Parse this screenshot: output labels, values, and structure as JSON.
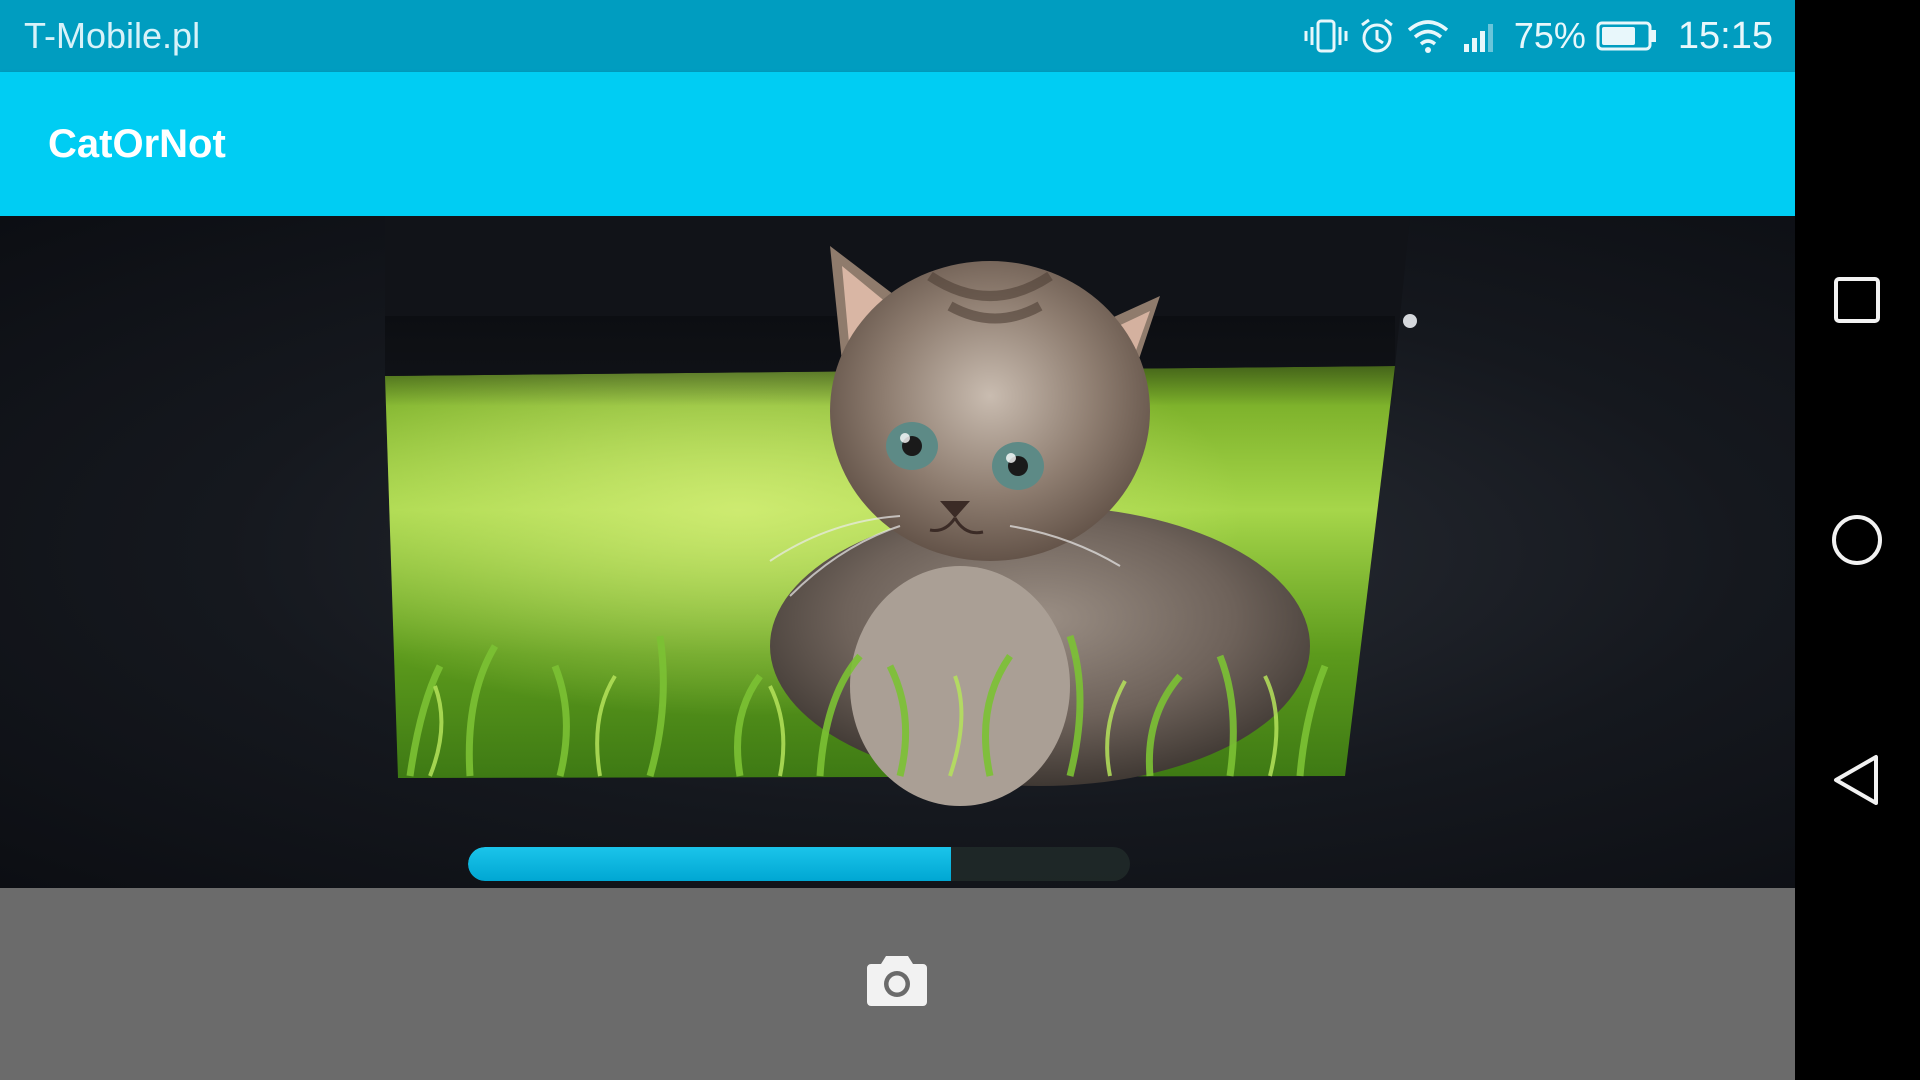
{
  "status_bar": {
    "carrier": "T-Mobile.pl",
    "battery_percent": "75%",
    "time": "15:15",
    "icons": [
      "vibrate-icon",
      "alarm-icon",
      "wifi-icon",
      "signal-icon",
      "battery-icon"
    ],
    "battery_level": 0.75
  },
  "app_bar": {
    "title": "CatOrNot",
    "color": "#00cdf3"
  },
  "camera": {
    "subject": "kitten-photo",
    "progress": 0.73,
    "progress_color": "#00b4df"
  },
  "bottom_bar": {
    "capture_icon": "camera-icon"
  },
  "nav": {
    "icons": [
      "recents-icon",
      "home-icon",
      "back-icon"
    ]
  },
  "colors": {
    "status_bar": "#009dc0",
    "bottom_bar": "#6b6b6b"
  }
}
